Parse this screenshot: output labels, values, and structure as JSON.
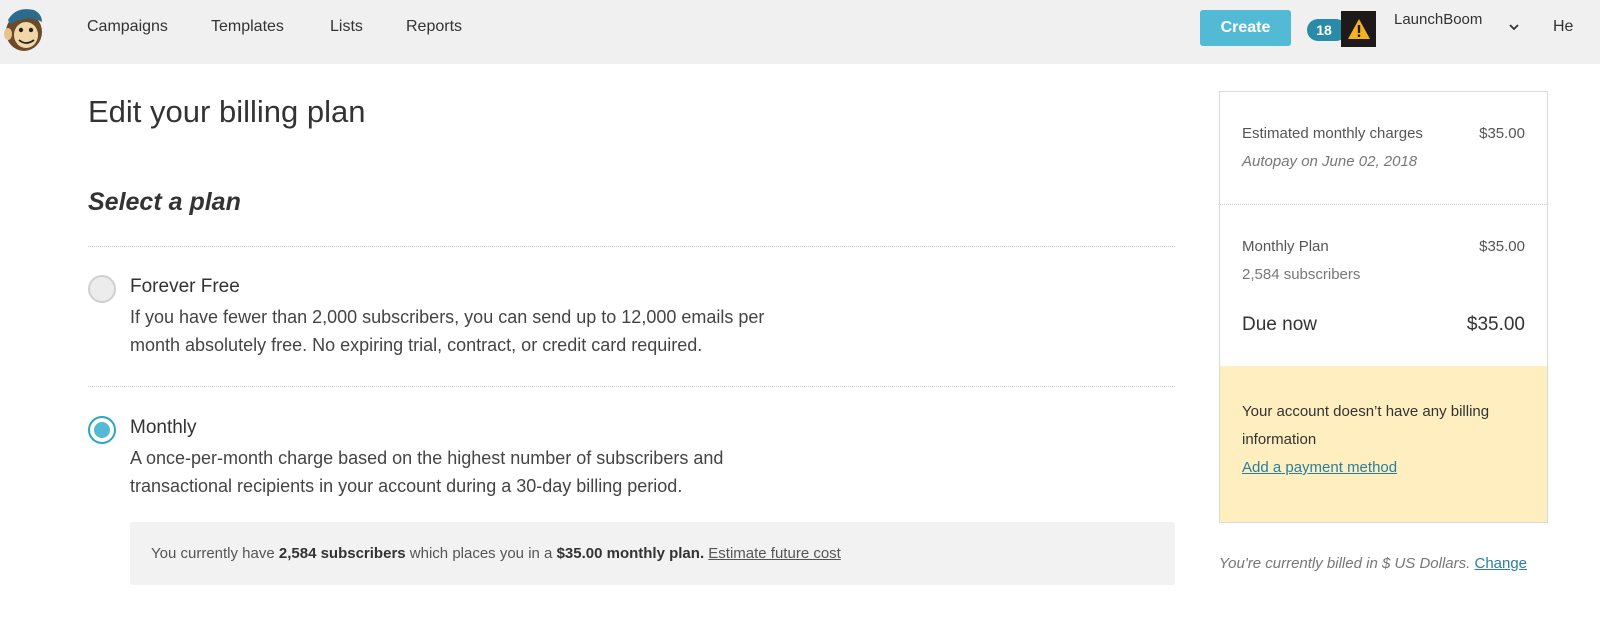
{
  "nav": {
    "items": [
      "Campaigns",
      "Templates",
      "Lists",
      "Reports"
    ],
    "create_label": "Create",
    "notification_count": "18",
    "account_name": "LaunchBoom",
    "help_label": "He"
  },
  "main": {
    "title": "Edit your billing plan",
    "section_title": "Select a plan",
    "plans": [
      {
        "name": "Forever Free",
        "description": "If you have fewer than 2,000 subscribers, you can send up to 12,000 emails per month absolutely free. No expiring trial, contract, or credit card required.",
        "selected": false
      },
      {
        "name": "Monthly",
        "description": "A once-per-month charge based on the highest number of subscribers and transactional recipients in your account during a 30-day billing period.",
        "selected": true
      }
    ],
    "info": {
      "prefix": "You currently have",
      "subscribers": "2,584 subscribers",
      "middle": "which places you in a",
      "plan": "$35.00 monthly plan.",
      "link": "Estimate future cost"
    }
  },
  "sidebar": {
    "estimated_label": "Estimated monthly charges",
    "estimated_amount": "$35.00",
    "autopay": "Autopay on June 02, 2018",
    "plan_label": "Monthly Plan",
    "plan_amount": "$35.00",
    "plan_subscribers": "2,584 subscribers",
    "due_label": "Due now",
    "due_amount": "$35.00",
    "warning_text": "Your account doesn’t have any billing information",
    "warning_link": "Add a payment method",
    "billed_note": "You're currently billed in $ US Dollars.",
    "change_link": "Change"
  },
  "colors": {
    "accent": "#52bad5",
    "badge": "#2a8ba9",
    "warning_bg": "#feeec0",
    "link": "#2a7f9e"
  }
}
